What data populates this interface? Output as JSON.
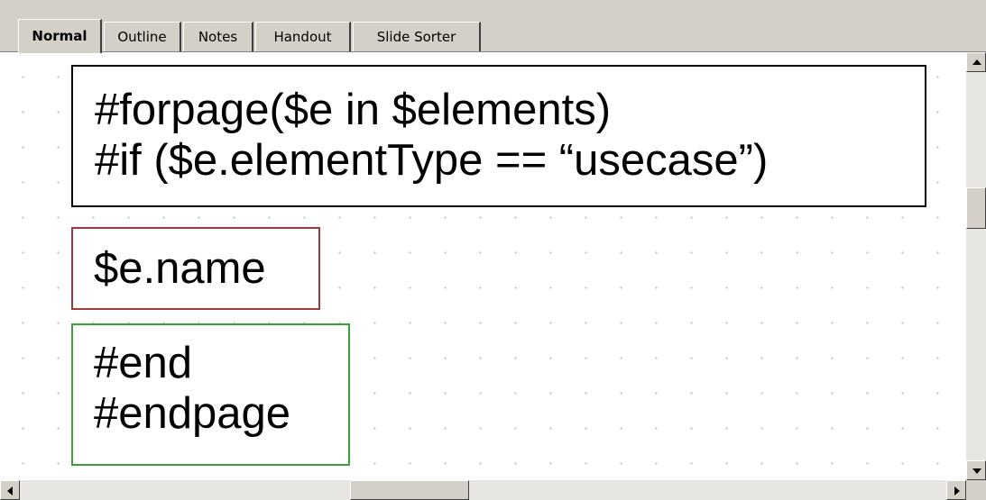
{
  "tabs": [
    {
      "label": "Normal",
      "active": true
    },
    {
      "label": "Outline",
      "active": false
    },
    {
      "label": "Notes",
      "active": false
    },
    {
      "label": "Handout",
      "active": false
    },
    {
      "label": "Slide Sorter",
      "active": false
    }
  ],
  "slide": {
    "loop_box": {
      "lines": [
        "#forpage($e in $elements)",
        "#if ($e.elementType == “usecase”)"
      ],
      "border_color": "#000000"
    },
    "name_box": {
      "lines": [
        "$e.name"
      ],
      "border_color": "#9e3a3a"
    },
    "end_box": {
      "lines": [
        "#end",
        "#endpage"
      ],
      "border_color": "#3aa03a"
    }
  },
  "scrollbars": {
    "vertical": {
      "up_icon": "arrow-up-icon",
      "down_icon": "arrow-down-icon"
    },
    "horizontal": {
      "left_icon": "arrow-left-icon",
      "right_icon": "arrow-right-icon"
    }
  },
  "colors": {
    "chrome": "#d4d0c8",
    "canvas": "#ffffff",
    "grid_dot": "#c8c8c8"
  }
}
